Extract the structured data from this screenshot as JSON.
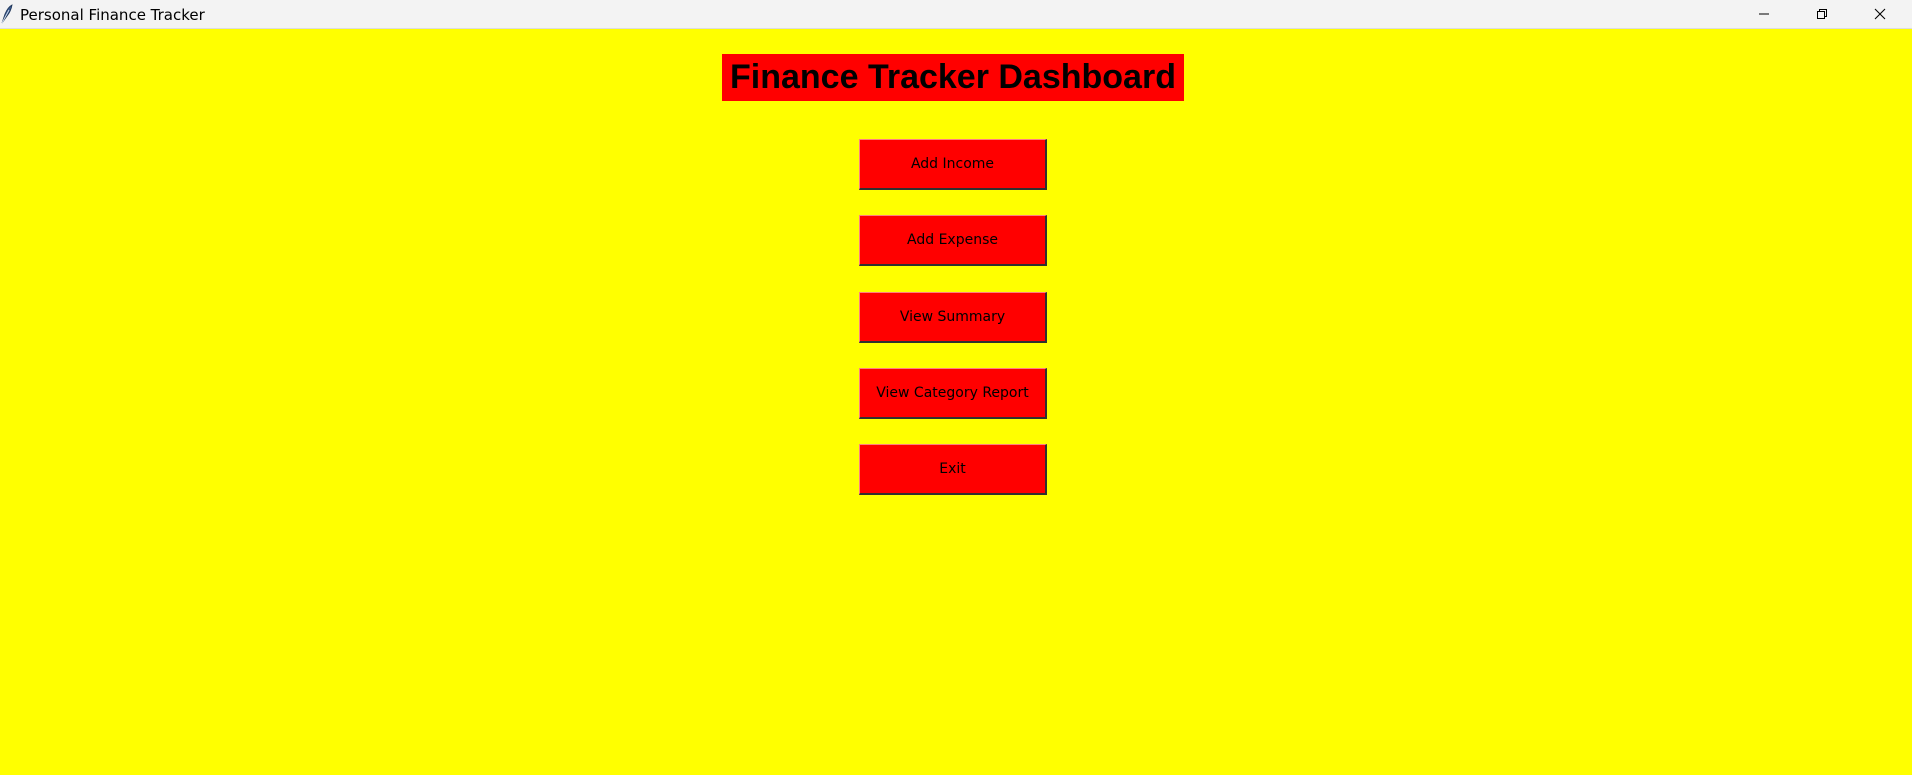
{
  "window": {
    "title": "Personal Finance Tracker",
    "controls": {
      "minimize_icon": "minimize-icon",
      "maximize_icon": "restore-icon",
      "close_icon": "close-icon"
    }
  },
  "dashboard": {
    "title": "Finance Tracker Dashboard",
    "buttons": [
      {
        "label": "Add Income"
      },
      {
        "label": "Add Expense"
      },
      {
        "label": "View Summary"
      },
      {
        "label": "View Category Report"
      },
      {
        "label": "Exit"
      }
    ]
  },
  "colors": {
    "background": "#ffff00",
    "accent": "#ff0000",
    "text": "#000000"
  }
}
